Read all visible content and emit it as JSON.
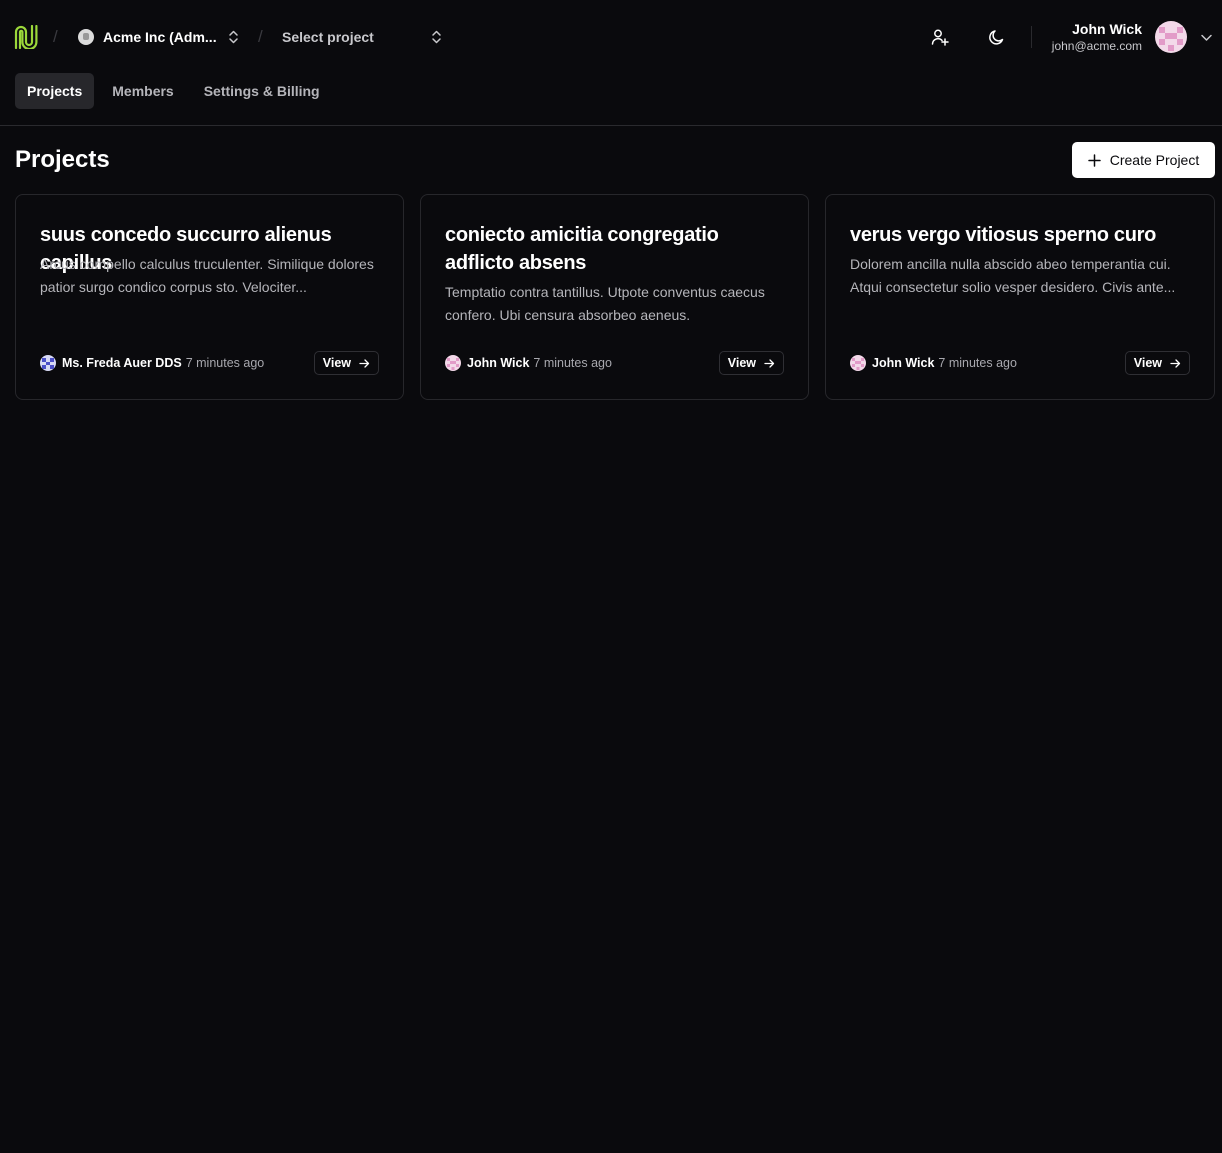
{
  "header": {
    "org_name": "Acme Inc (Adm...",
    "project_placeholder": "Select project",
    "user": {
      "name": "John Wick",
      "email": "john@acme.com"
    }
  },
  "tabs": [
    {
      "label": "Projects",
      "active": true
    },
    {
      "label": "Members",
      "active": false
    },
    {
      "label": "Settings & Billing",
      "active": false
    }
  ],
  "page": {
    "title": "Projects",
    "create_label": "Create Project"
  },
  "projects": [
    {
      "title": "suus concedo succurro alienus capillus",
      "description": "Arcus compello calculus truculenter. Similique dolores patior surgo condico corpus sto. Velociter...",
      "author": "Ms. Freda Auer DDS",
      "time": "7 minutes ago",
      "view_label": "View"
    },
    {
      "title": "coniecto amicitia congregatio adflicto absens",
      "description": "Temptatio contra tantillus. Utpote conventus caecus confero. Ubi censura absorbeo aeneus.",
      "author": "John Wick",
      "time": "7 minutes ago",
      "view_label": "View"
    },
    {
      "title": "verus vergo vitiosus sperno curo",
      "description": "Dolorem ancilla nulla abscido abeo temperantia cui. Atqui consectetur solio vesper desidero. Civis ante...",
      "author": "John Wick",
      "time": "7 minutes ago",
      "view_label": "View"
    }
  ],
  "colors": {
    "background": "#0a0a0d",
    "logo_accent": "#9bd83a",
    "card_border": "#27272b",
    "primary_button_bg": "#ffffff"
  }
}
